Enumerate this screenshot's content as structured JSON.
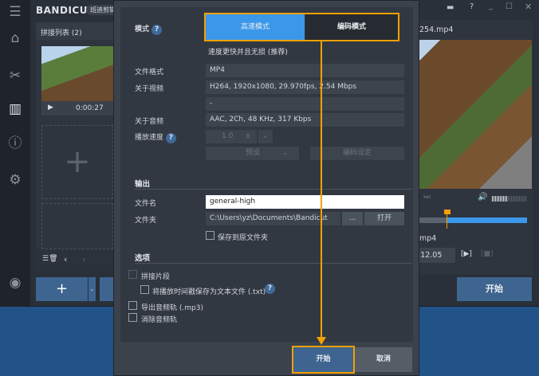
{
  "app": {
    "logo": "BANDICUT",
    "badge": "班迪剪辑",
    "list_title": "拼接列表 (2)",
    "clip_time": "0:00:27",
    "filename_partial": "254.mp4",
    "filename2_partial": "mp4",
    "time_value": ":12.05",
    "play_seg": "[▶]",
    "stop_seg": "[■]",
    "start_label": "开始",
    "timeline_progress": 0.26,
    "volume_level": 0.45
  },
  "sidebar": {
    "icons": [
      "menu-icon",
      "home-icon",
      "cut-icon",
      "join-icon",
      "info-icon",
      "gear-icon",
      "record-icon"
    ]
  },
  "dialog": {
    "mode_label": "模式",
    "mode_fast": "高速模式",
    "mode_encode": "编码模式",
    "mode_desc": "速度更快并且无损 (推荐)",
    "format_label": "文件格式",
    "format_value": "MP4",
    "video_label": "关于视频",
    "video_value": "H264, 1920x1080, 29.970fps, 2.54 Mbps",
    "video_extra": "-",
    "audio_label": "关于音频",
    "audio_value": "AAC, 2Ch, 48 KHz, 317 Kbps",
    "speed_label": "播放速度",
    "speed_value": "1.0",
    "speed_unit": "x",
    "preset_label": "预设",
    "encode_settings": "编码设定",
    "output_section": "输出",
    "filename_label": "文件名",
    "filename_value": "general-high",
    "folder_label": "文件夹",
    "folder_value": "C:\\Users\\yz\\Documents\\Bandicut",
    "browse_label": "...",
    "open_label": "打开",
    "save_to_source": "保存到原文件夹",
    "options_section": "选项",
    "join_segments": "拼接片段",
    "save_timestamps": "将播放时间戳保存为文本文件 (.txt)",
    "export_audio": "导出音频轨 (.mp3)",
    "remove_audio": "消除音频轨",
    "start": "开始",
    "cancel": "取消",
    "help": "?"
  },
  "colors": {
    "accent": "#3a97ea",
    "highlight": "#f5a000",
    "button": "#3d6590"
  }
}
